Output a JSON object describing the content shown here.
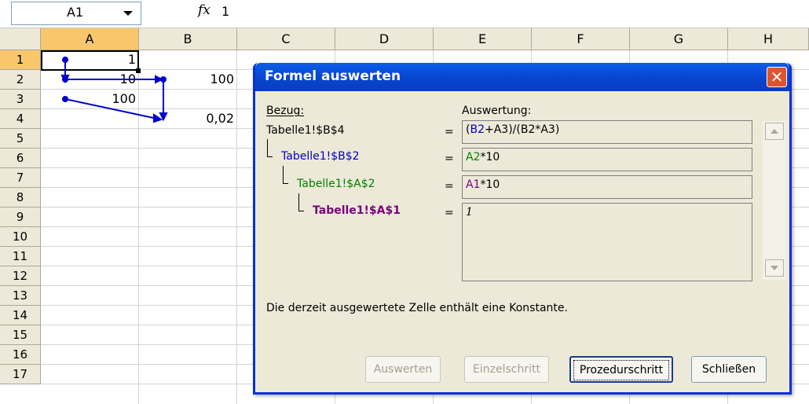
{
  "formula_bar": {
    "name_box": "A1",
    "fx_icon": "fx",
    "formula": "1"
  },
  "columns": [
    "A",
    "B",
    "C",
    "D",
    "E",
    "F",
    "G",
    "H"
  ],
  "rows": [
    "1",
    "2",
    "3",
    "4",
    "5",
    "6",
    "7",
    "8",
    "9",
    "10",
    "11",
    "12",
    "13",
    "14",
    "15",
    "16",
    "17"
  ],
  "cells": {
    "A1": "1",
    "A2": "10",
    "A3": "100",
    "B2": "100",
    "B4": "0,02"
  },
  "dialog": {
    "title": "Formel auswerten",
    "close_icon": "close-icon",
    "bezug_label": "Bezug:",
    "auswertung_label": "Auswertung:",
    "refs": [
      {
        "text": "Tabelle1!$B$4",
        "color": "#000000"
      },
      {
        "text": "Tabelle1!$B$2",
        "color": "#0000c0"
      },
      {
        "text": "Tabelle1!$A$2",
        "color": "#008000"
      },
      {
        "text": "Tabelle1!$A$1",
        "color": "#7a007a"
      }
    ],
    "eq": "=",
    "eval": {
      "e0": {
        "p1": "(",
        "p2": "B2",
        "p3": "+A3)/(B2*A3)"
      },
      "e1": {
        "p1": "A2",
        "p2": "*10"
      },
      "e2": {
        "p1": "A1",
        "p2": "*10"
      },
      "e3": {
        "p1": "1"
      }
    },
    "status": "Die derzeit ausgewertete Zelle enthält eine Konstante.",
    "buttons": {
      "evaluate": "Auswerten",
      "step_in": "Einzelschritt",
      "step_out": "Prozedurschritt",
      "close": "Schließen"
    }
  },
  "colors": {
    "title_bar": "#0a5ee9",
    "selected_header": "#f9c76b",
    "trace_arrow": "#0000cc"
  }
}
